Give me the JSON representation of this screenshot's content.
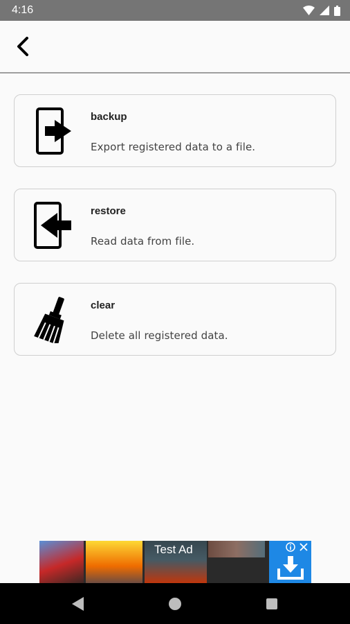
{
  "status_bar": {
    "time": "4:16",
    "icons": [
      "wifi-icon",
      "cellular-icon",
      "battery-icon"
    ]
  },
  "app_bar": {
    "back_icon": "chevron-left-icon"
  },
  "options": [
    {
      "id": "backup",
      "icon": "export-to-file-icon",
      "title": "backup",
      "description": "Export registered data to a file."
    },
    {
      "id": "restore",
      "icon": "import-from-file-icon",
      "title": "restore",
      "description": "Read data from file."
    },
    {
      "id": "clear",
      "icon": "broom-icon",
      "title": "clear",
      "description": "Delete all registered data."
    }
  ],
  "ad": {
    "label": "Test Ad",
    "icons": [
      "ad-info-icon",
      "ad-close-icon",
      "download-icon"
    ]
  },
  "nav_bar": {
    "icons": [
      "back-triangle-icon",
      "home-circle-icon",
      "recents-square-icon"
    ]
  },
  "colors": {
    "status_bar": "#757575",
    "background": "#fafafa",
    "card_border": "#cfcfcf",
    "ad_install": "#1e88e5",
    "nav_bar": "#000000"
  }
}
